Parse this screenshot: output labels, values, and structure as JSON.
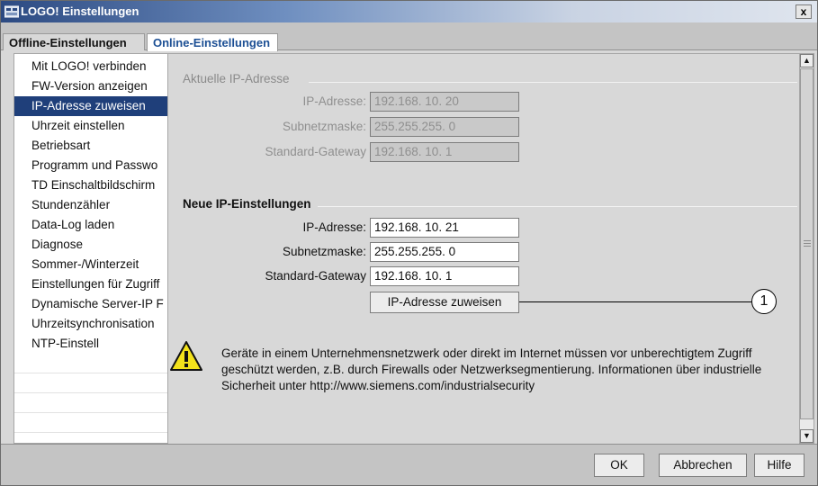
{
  "window": {
    "title": "LOGO! Einstellungen",
    "close_label": "x"
  },
  "tabs": [
    {
      "label": "Offline-Einstellungen",
      "active": false
    },
    {
      "label": "Online-Einstellungen",
      "active": true
    }
  ],
  "sidebar": {
    "items": [
      {
        "label": "Mit LOGO! verbinden",
        "selected": false
      },
      {
        "label": "FW-Version anzeigen",
        "selected": false
      },
      {
        "label": "IP-Adresse zuweisen",
        "selected": true
      },
      {
        "label": "Uhrzeit einstellen",
        "selected": false
      },
      {
        "label": "Betriebsart",
        "selected": false
      },
      {
        "label": "Programm und Passwo",
        "selected": false
      },
      {
        "label": "TD Einschaltbildschirm",
        "selected": false
      },
      {
        "label": "Stundenzähler",
        "selected": false
      },
      {
        "label": "Data-Log laden",
        "selected": false
      },
      {
        "label": "Diagnose",
        "selected": false
      },
      {
        "label": "Sommer-/Winterzeit",
        "selected": false
      },
      {
        "label": "Einstellungen für Zugriff",
        "selected": false
      },
      {
        "label": "Dynamische Server-IP F",
        "selected": false
      },
      {
        "label": "Uhrzeitsynchronisation",
        "selected": false
      },
      {
        "label": "NTP-Einstell",
        "selected": false
      }
    ]
  },
  "current_ip": {
    "title": "Aktuelle IP-Adresse",
    "ip_label": "IP-Adresse:",
    "ip_value": "192.168. 10. 20",
    "subnet_label": "Subnetzmaske:",
    "subnet_value": "255.255.255.  0",
    "gateway_label": "Standard-Gateway",
    "gateway_value": "192.168. 10.  1"
  },
  "new_ip": {
    "title": "Neue IP-Einstellungen",
    "ip_label": "IP-Adresse:",
    "ip_value": "192.168. 10. 21",
    "subnet_label": "Subnetzmaske:",
    "subnet_value": "255.255.255.  0",
    "gateway_label": "Standard-Gateway",
    "gateway_value": "192.168. 10.  1",
    "assign_button": "IP-Adresse zuweisen"
  },
  "callout_number": "1",
  "warning": {
    "text": "Geräte in einem Unternehmensnetzwerk oder direkt im Internet müssen vor unberechtigtem Zugriff geschützt werden, z.B. durch Firewalls oder Netzwerksegmentierung. Informationen über industrielle Sicherheit unter http://www.siemens.com/industrialsecurity",
    "icon": "warning-triangle-icon"
  },
  "footer": {
    "ok_label": "OK",
    "cancel_label": "Abbrechen",
    "help_label": "Hilfe"
  },
  "colors": {
    "selection": "#1f3f7a",
    "active_tab_text": "#1c4f94",
    "warning_yellow": "#f3e21b"
  }
}
